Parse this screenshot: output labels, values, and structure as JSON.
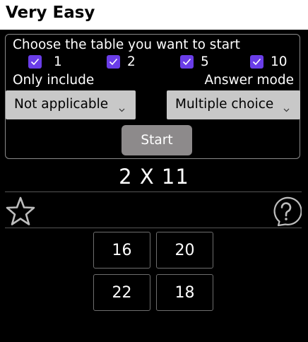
{
  "header": {
    "title": "Very Easy"
  },
  "setup": {
    "choose_label": "Choose the table you want to start",
    "tables": [
      {
        "label": "1",
        "checked": true
      },
      {
        "label": "2",
        "checked": true
      },
      {
        "label": "5",
        "checked": true
      },
      {
        "label": "10",
        "checked": true
      }
    ],
    "only_include_label": "Only include",
    "only_include_value": "Not applicable",
    "answer_mode_label": "Answer mode",
    "answer_mode_value": "Multiple choice",
    "start_label": "Start"
  },
  "quiz": {
    "question": "2 X 11",
    "answers": [
      "16",
      "20",
      "22",
      "18"
    ]
  },
  "colors": {
    "checkbox": "#6a3de8",
    "button": "#8d8a8b",
    "select": "#c8c8c8",
    "background": "#000000"
  }
}
